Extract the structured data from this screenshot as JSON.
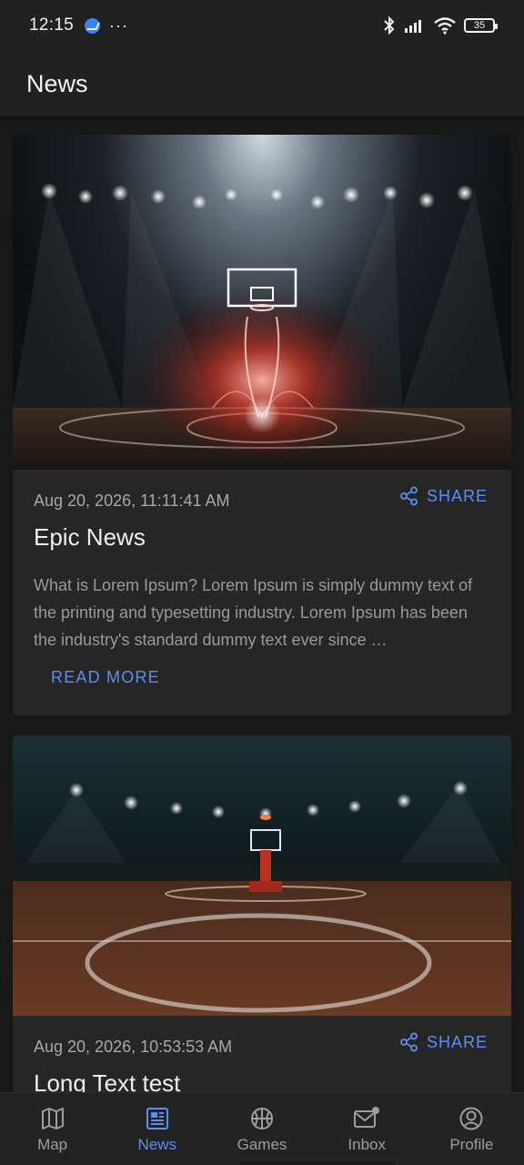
{
  "status_bar": {
    "time": "12:15",
    "dots": "···",
    "battery": "35"
  },
  "app_bar": {
    "title": "News"
  },
  "articles": [
    {
      "date": "Aug 20, 2026, 11:11:41 AM",
      "share_label": "SHARE",
      "title": "Epic News",
      "excerpt": "What is Lorem Ipsum? Lorem Ipsum is simply dummy text of the printing and typesetting industry. Lorem Ipsum has been the industry's standard dummy text ever since …",
      "read_more": "READ MORE"
    },
    {
      "date": "Aug 20, 2026, 10:53:53 AM",
      "share_label": "SHARE",
      "title": "Long Text test"
    }
  ],
  "bottom_nav": {
    "items": [
      {
        "label": "Map",
        "icon": "map-icon"
      },
      {
        "label": "News",
        "icon": "newspaper-icon",
        "active": true
      },
      {
        "label": "Games",
        "icon": "basketball-icon"
      },
      {
        "label": "Inbox",
        "icon": "inbox-icon"
      },
      {
        "label": "Profile",
        "icon": "profile-icon"
      }
    ]
  },
  "colors": {
    "accent": "#5b8ef0",
    "background": "#181818",
    "surface": "#262626",
    "bar": "#212121"
  }
}
